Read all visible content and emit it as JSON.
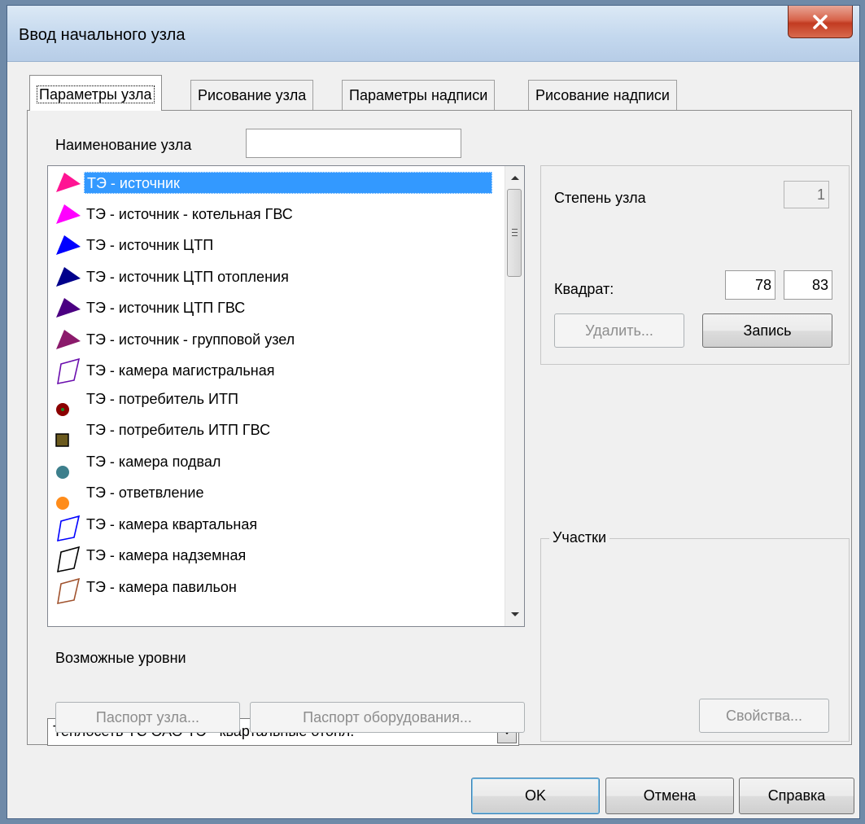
{
  "window": {
    "title": "Ввод начального узла"
  },
  "tabs": [
    {
      "label": "Параметры узла"
    },
    {
      "label": "Рисование узла"
    },
    {
      "label": "Параметры надписи"
    },
    {
      "label": "Рисование надписи"
    }
  ],
  "node_name": {
    "label": "Наименование узла",
    "value": ""
  },
  "node_types": [
    {
      "label": "ТЭ - источник",
      "icon": "triangle-flag-icon",
      "color": "#ff1493",
      "selected": true
    },
    {
      "label": "ТЭ - источник - котельная ГВС",
      "icon": "triangle-flag-icon",
      "color": "#ff00ff"
    },
    {
      "label": "ТЭ - источник ЦТП",
      "icon": "triangle-flag-icon",
      "color": "#0000ff"
    },
    {
      "label": "ТЭ - источник ЦТП отопления",
      "icon": "triangle-flag-icon",
      "color": "#00008b"
    },
    {
      "label": "ТЭ - источник ЦТП ГВС",
      "icon": "triangle-flag-icon",
      "color": "#4b0082"
    },
    {
      "label": "ТЭ - источник - групповой узел",
      "icon": "triangle-flag-icon",
      "color": "#8b1a6b"
    },
    {
      "label": "ТЭ - камера магистральная",
      "icon": "parallelogram-icon",
      "color": "#6a0dad"
    },
    {
      "label": "ТЭ - потребитель ИТП",
      "icon": "circle-icon",
      "color": "#8b0000"
    },
    {
      "label": "ТЭ - потребитель ИТП ГВС",
      "icon": "square-icon",
      "color": "#6b5a1e"
    },
    {
      "label": "ТЭ - камера подвал",
      "icon": "circle-icon",
      "color": "#3d7f8c"
    },
    {
      "label": "ТЭ - ответвление",
      "icon": "circle-icon",
      "color": "#ff8c1a"
    },
    {
      "label": "ТЭ - камера квартальная",
      "icon": "parallelogram-icon",
      "color": "#0000ff"
    },
    {
      "label": "ТЭ - камера надземная",
      "icon": "parallelogram-icon",
      "color": "#000000"
    },
    {
      "label": "ТЭ - камера павильон",
      "icon": "parallelogram-icon",
      "color": "#a0522d"
    }
  ],
  "levels": {
    "label": "Возможные уровни",
    "selected": "Теплосеть ТС ОАО ТЭ - квартальные отопл."
  },
  "buttons": {
    "node_passport": "Паспорт узла...",
    "equipment_passport": "Паспорт оборудования...",
    "delete": "Удалить...",
    "record": "Запись",
    "properties": "Свойства...",
    "ok": "OK",
    "cancel": "Отмена",
    "help": "Справка"
  },
  "degree": {
    "label": "Степень узла",
    "value": "1"
  },
  "square": {
    "label": "Квадрат:",
    "x": "78",
    "y": "83"
  },
  "sections": {
    "label": "Участки"
  }
}
